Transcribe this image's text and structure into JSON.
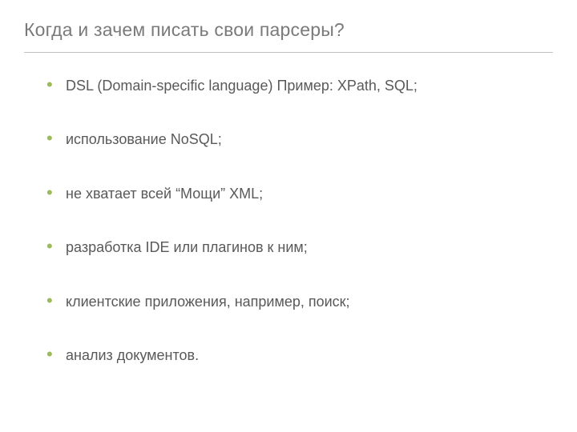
{
  "title": "Когда и зачем писать свои парсеры?",
  "bullets": [
    "DSL (Domain-specific language) Пример: XPath, SQL;",
    "использование NoSQL;",
    "не хватает всей “Мощи” XML;",
    "разработка IDE или плагинов к ним;",
    "клиентские приложения, например, поиск;",
    "анализ документов."
  ],
  "colors": {
    "bullet_accent": "#9bbb59",
    "text": "#595959",
    "title": "#7a7a7a",
    "divider": "#bfbfbf"
  }
}
